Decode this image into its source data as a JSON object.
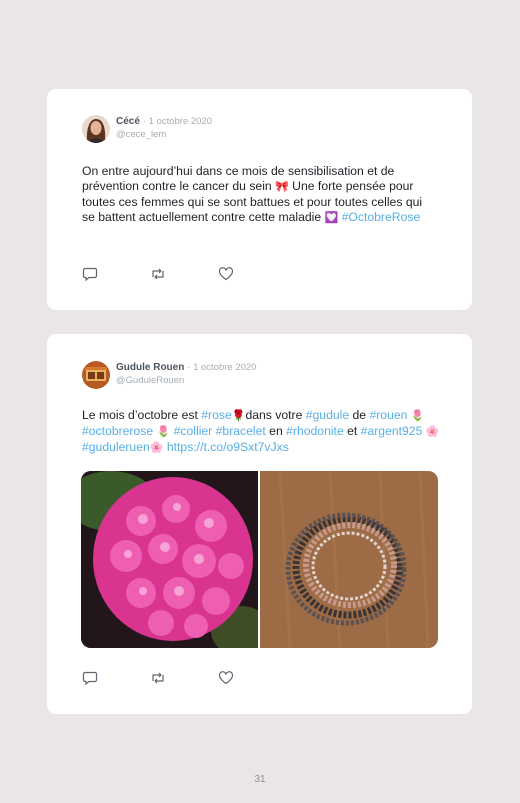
{
  "tweets": [
    {
      "author": "Cécé",
      "separator": "·",
      "date": "1 octobre 2020",
      "handle": "@cece_lem",
      "text_parts": [
        {
          "t": "On entre aujourd’hui dans ce mois de sensibilisation et de prévention contre le cancer du sein "
        },
        {
          "t": "🎀",
          "emoji": true
        },
        {
          "t": " Une forte pensée pour toutes ces femmes qui se sont battues et pour toutes celles qui se battent actuellement contre cette maladie "
        },
        {
          "t": "💟",
          "emoji": true
        },
        {
          "t": " "
        },
        {
          "t": "#OctobreRose",
          "link": true
        }
      ]
    },
    {
      "author": "Gudule Rouen",
      "separator": "·",
      "date": "1 octobre 2020",
      "handle": "@GuduleRouen",
      "text_parts": [
        {
          "t": "Le mois d’octobre est "
        },
        {
          "t": "#rose",
          "link": true
        },
        {
          "t": "🌹",
          "emoji": true
        },
        {
          "t": "dans votre "
        },
        {
          "t": "#gudule",
          "link": true
        },
        {
          "t": " de "
        },
        {
          "t": "#rouen",
          "link": true
        },
        {
          "t": " "
        },
        {
          "t": "🌷",
          "emoji": true
        },
        {
          "t": "#octobrerose",
          "link": true
        },
        {
          "t": " "
        },
        {
          "t": "🌷",
          "emoji": true
        },
        {
          "t": " "
        },
        {
          "t": "#collier",
          "link": true
        },
        {
          "t": " "
        },
        {
          "t": "#bracelet",
          "link": true
        },
        {
          "t": " en "
        },
        {
          "t": "#rhodonite",
          "link": true
        },
        {
          "t": " et "
        },
        {
          "t": "#argent925",
          "link": true
        },
        {
          "t": " "
        },
        {
          "t": "🌸",
          "emoji": true
        },
        {
          "t": " "
        },
        {
          "t": "#guduleruen",
          "link": true
        },
        {
          "t": "🌸",
          "emoji": true
        },
        {
          "t": " "
        },
        {
          "t": "https://t.co/o9Sxt7vJxs",
          "link": true
        }
      ],
      "media": [
        "pink-hydrangea-photo",
        "rhodonite-bracelet-photo"
      ]
    }
  ],
  "icons": [
    "reply-icon",
    "retweet-icon",
    "like-icon"
  ],
  "colors": {
    "background": "#ebe6e6",
    "card": "#ffffff",
    "link": "#58aee6",
    "muted": "#a5adb5"
  },
  "page_number": "31"
}
